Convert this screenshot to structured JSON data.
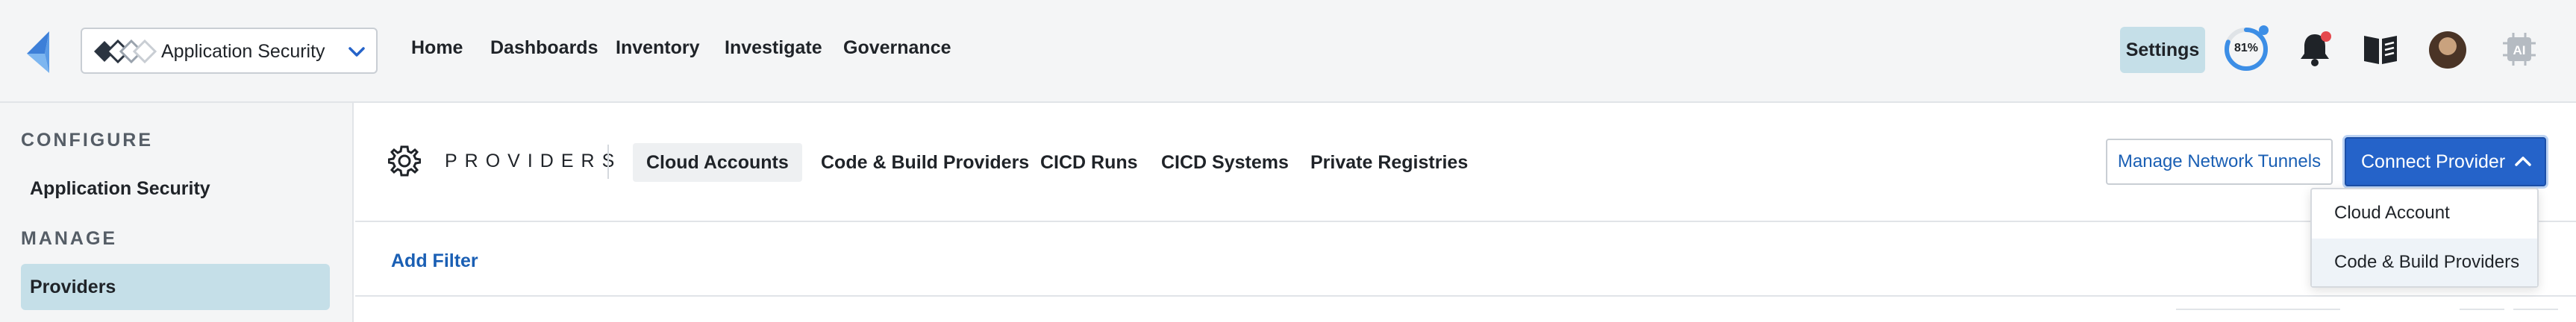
{
  "header": {
    "app_switcher": {
      "name": "Application Security"
    },
    "nav": [
      "Home",
      "Dashboards",
      "Inventory",
      "Investigate",
      "Governance"
    ],
    "settings_label": "Settings",
    "progress_label": "81%",
    "progress_value": 0.81,
    "icons": [
      "bell-icon",
      "book-icon",
      "avatar",
      "ai-icon"
    ]
  },
  "sidebar": {
    "configure_heading": "CONFIGURE",
    "configure_items": [
      {
        "label": "Application Security"
      }
    ],
    "manage_heading": "MANAGE",
    "manage_items": [
      {
        "label": "Providers",
        "active": true
      }
    ]
  },
  "main": {
    "section_title": "PROVIDERS",
    "tabs": [
      {
        "label": "Cloud Accounts",
        "active": true
      },
      {
        "label": "Code & Build Providers"
      },
      {
        "label": "CICD Runs"
      },
      {
        "label": "CICD Systems"
      },
      {
        "label": "Private Registries"
      }
    ],
    "tunnels_button": "Manage Network Tunnels",
    "connect_button": "Connect Provider",
    "add_filter": "Add Filter",
    "connect_menu": [
      "Cloud Account",
      "Code & Build Providers"
    ]
  },
  "colors": {
    "accent": "#2563c9",
    "link": "#1a5fb4",
    "active_bg": "#c5dfe8",
    "notification": "#e5484d"
  }
}
